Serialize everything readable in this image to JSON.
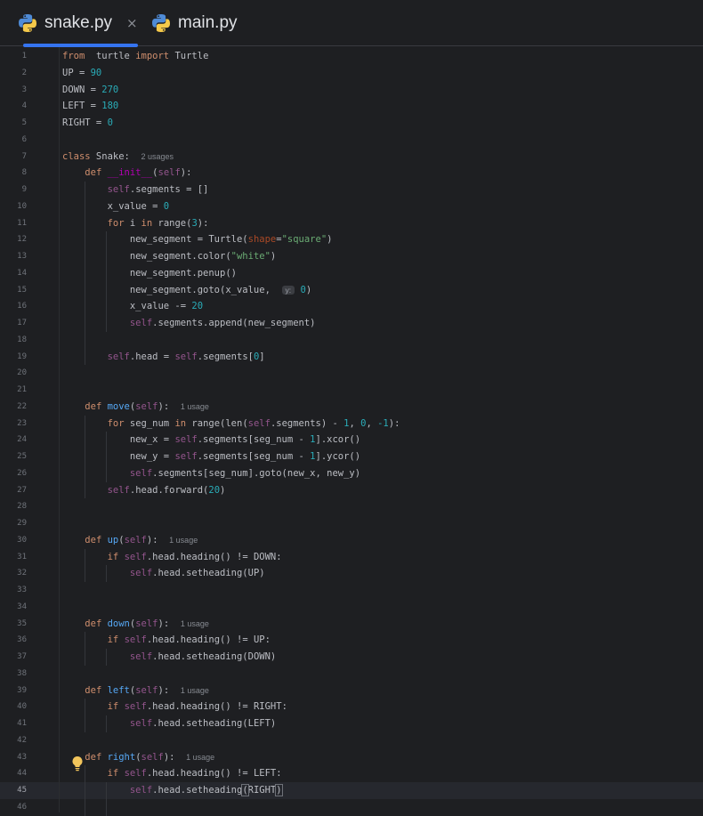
{
  "tabs": [
    {
      "label": "snake.py",
      "close": "×",
      "active": true,
      "icon": "python-icon"
    },
    {
      "label": "main.py",
      "active": false,
      "icon": "python-icon"
    }
  ],
  "editor": {
    "current_line": 45,
    "lines": [
      {
        "n": "1",
        "t": [
          [
            "k",
            "from"
          ],
          [
            "",
            "  turtle "
          ],
          [
            "k",
            "import"
          ],
          [
            "",
            " Turtle"
          ]
        ]
      },
      {
        "n": "2",
        "t": [
          [
            "",
            "UP = "
          ],
          [
            "n",
            "90"
          ]
        ]
      },
      {
        "n": "3",
        "t": [
          [
            "",
            "DOWN = "
          ],
          [
            "n",
            "270"
          ]
        ]
      },
      {
        "n": "4",
        "t": [
          [
            "",
            "LEFT = "
          ],
          [
            "n",
            "180"
          ]
        ]
      },
      {
        "n": "5",
        "t": [
          [
            "",
            "RIGHT = "
          ],
          [
            "n",
            "0"
          ]
        ]
      },
      {
        "n": "6",
        "t": []
      },
      {
        "n": "7",
        "t": [
          [
            "k",
            "class"
          ],
          [
            "",
            " Snake:  "
          ],
          [
            "hint",
            "2 usages"
          ]
        ]
      },
      {
        "n": "8",
        "t": [
          [
            "",
            "    "
          ],
          [
            "k",
            "def"
          ],
          [
            "",
            " "
          ],
          [
            "m",
            "__init__"
          ],
          [
            "",
            "("
          ],
          [
            "sf",
            "self"
          ],
          [
            "",
            "):"
          ]
        ]
      },
      {
        "n": "9",
        "t": [
          [
            "",
            "        "
          ],
          [
            "sf",
            "self"
          ],
          [
            "",
            ".segments = []"
          ]
        ]
      },
      {
        "n": "10",
        "t": [
          [
            "",
            "        x_value = "
          ],
          [
            "n",
            "0"
          ]
        ]
      },
      {
        "n": "11",
        "t": [
          [
            "",
            "        "
          ],
          [
            "k",
            "for"
          ],
          [
            "",
            " i "
          ],
          [
            "k",
            "in"
          ],
          [
            "",
            " range("
          ],
          [
            "n",
            "3"
          ],
          [
            "",
            "):"
          ]
        ]
      },
      {
        "n": "12",
        "t": [
          [
            "",
            "            new_segment = Turtle("
          ],
          [
            "p",
            "shape"
          ],
          [
            "",
            "="
          ],
          [
            "s",
            "\"square\""
          ],
          [
            "",
            ")"
          ]
        ]
      },
      {
        "n": "13",
        "t": [
          [
            "",
            "            new_segment.color("
          ],
          [
            "s",
            "\"white\""
          ],
          [
            "",
            ")"
          ]
        ]
      },
      {
        "n": "14",
        "t": [
          [
            "",
            "            new_segment.penup()"
          ]
        ]
      },
      {
        "n": "15",
        "t": [
          [
            "",
            "            new_segment.goto(x_value,  "
          ],
          [
            "ph",
            "y:"
          ],
          [
            "",
            " "
          ],
          [
            "n",
            "0"
          ],
          [
            "",
            ")"
          ]
        ]
      },
      {
        "n": "16",
        "t": [
          [
            "",
            "            x_value -= "
          ],
          [
            "n",
            "20"
          ]
        ]
      },
      {
        "n": "17",
        "t": [
          [
            "",
            "            "
          ],
          [
            "sf",
            "self"
          ],
          [
            "",
            ".segments.append(new_segment)"
          ]
        ]
      },
      {
        "n": "18",
        "t": []
      },
      {
        "n": "19",
        "t": [
          [
            "",
            "        "
          ],
          [
            "sf",
            "self"
          ],
          [
            "",
            ".head = "
          ],
          [
            "sf",
            "self"
          ],
          [
            "",
            ".segments["
          ],
          [
            "n",
            "0"
          ],
          [
            "",
            "]"
          ]
        ]
      },
      {
        "n": "20",
        "t": []
      },
      {
        "n": "21",
        "t": []
      },
      {
        "n": "22",
        "t": [
          [
            "",
            "    "
          ],
          [
            "k",
            "def"
          ],
          [
            "",
            " "
          ],
          [
            "f",
            "move"
          ],
          [
            "",
            "("
          ],
          [
            "sf",
            "self"
          ],
          [
            "",
            "):  "
          ],
          [
            "hint",
            "1 usage"
          ]
        ]
      },
      {
        "n": "23",
        "t": [
          [
            "",
            "        "
          ],
          [
            "k",
            "for"
          ],
          [
            "",
            " seg_num "
          ],
          [
            "k",
            "in"
          ],
          [
            "",
            " range(len("
          ],
          [
            "sf",
            "self"
          ],
          [
            "",
            ".segments) - "
          ],
          [
            "n",
            "1"
          ],
          [
            "",
            ", "
          ],
          [
            "n",
            "0"
          ],
          [
            "",
            ", "
          ],
          [
            "n",
            "-1"
          ],
          [
            "",
            "):"
          ]
        ]
      },
      {
        "n": "24",
        "t": [
          [
            "",
            "            new_x = "
          ],
          [
            "sf",
            "self"
          ],
          [
            "",
            ".segments[seg_num - "
          ],
          [
            "n",
            "1"
          ],
          [
            "",
            "].xcor()"
          ]
        ]
      },
      {
        "n": "25",
        "t": [
          [
            "",
            "            new_y = "
          ],
          [
            "sf",
            "self"
          ],
          [
            "",
            ".segments[seg_num - "
          ],
          [
            "n",
            "1"
          ],
          [
            "",
            "].ycor()"
          ]
        ]
      },
      {
        "n": "26",
        "t": [
          [
            "",
            "            "
          ],
          [
            "sf",
            "self"
          ],
          [
            "",
            ".segments[seg_num].goto(new_x, new_y)"
          ]
        ]
      },
      {
        "n": "27",
        "t": [
          [
            "",
            "        "
          ],
          [
            "sf",
            "self"
          ],
          [
            "",
            ".head.forward("
          ],
          [
            "n",
            "20"
          ],
          [
            "",
            ")"
          ]
        ]
      },
      {
        "n": "28",
        "t": []
      },
      {
        "n": "29",
        "t": []
      },
      {
        "n": "30",
        "t": [
          [
            "",
            "    "
          ],
          [
            "k",
            "def"
          ],
          [
            "",
            " "
          ],
          [
            "f",
            "up"
          ],
          [
            "",
            "("
          ],
          [
            "sf",
            "self"
          ],
          [
            "",
            "):  "
          ],
          [
            "hint",
            "1 usage"
          ]
        ]
      },
      {
        "n": "31",
        "t": [
          [
            "",
            "        "
          ],
          [
            "k",
            "if"
          ],
          [
            "",
            " "
          ],
          [
            "sf",
            "self"
          ],
          [
            "",
            ".head.heading() != DOWN:"
          ]
        ]
      },
      {
        "n": "32",
        "t": [
          [
            "",
            "            "
          ],
          [
            "sf",
            "self"
          ],
          [
            "",
            ".head.setheading(UP)"
          ]
        ]
      },
      {
        "n": "33",
        "t": []
      },
      {
        "n": "34",
        "t": []
      },
      {
        "n": "35",
        "t": [
          [
            "",
            "    "
          ],
          [
            "k",
            "def"
          ],
          [
            "",
            " "
          ],
          [
            "f",
            "down"
          ],
          [
            "",
            "("
          ],
          [
            "sf",
            "self"
          ],
          [
            "",
            "):  "
          ],
          [
            "hint",
            "1 usage"
          ]
        ]
      },
      {
        "n": "36",
        "t": [
          [
            "",
            "        "
          ],
          [
            "k",
            "if"
          ],
          [
            "",
            " "
          ],
          [
            "sf",
            "self"
          ],
          [
            "",
            ".head.heading() != UP:"
          ]
        ]
      },
      {
        "n": "37",
        "t": [
          [
            "",
            "            "
          ],
          [
            "sf",
            "self"
          ],
          [
            "",
            ".head.setheading(DOWN)"
          ]
        ]
      },
      {
        "n": "38",
        "t": []
      },
      {
        "n": "39",
        "t": [
          [
            "",
            "    "
          ],
          [
            "k",
            "def"
          ],
          [
            "",
            " "
          ],
          [
            "f",
            "left"
          ],
          [
            "",
            "("
          ],
          [
            "sf",
            "self"
          ],
          [
            "",
            "):  "
          ],
          [
            "hint",
            "1 usage"
          ]
        ]
      },
      {
        "n": "40",
        "t": [
          [
            "",
            "        "
          ],
          [
            "k",
            "if"
          ],
          [
            "",
            " "
          ],
          [
            "sf",
            "self"
          ],
          [
            "",
            ".head.heading() != RIGHT:"
          ]
        ]
      },
      {
        "n": "41",
        "t": [
          [
            "",
            "            "
          ],
          [
            "sf",
            "self"
          ],
          [
            "",
            ".head.setheading(LEFT)"
          ]
        ]
      },
      {
        "n": "42",
        "t": []
      },
      {
        "n": "43",
        "t": [
          [
            "",
            "    "
          ],
          [
            "k",
            "def"
          ],
          [
            "",
            " "
          ],
          [
            "f",
            "right"
          ],
          [
            "",
            "("
          ],
          [
            "sf",
            "self"
          ],
          [
            "",
            "):  "
          ],
          [
            "hint",
            "1 usage"
          ]
        ]
      },
      {
        "n": "44",
        "t": [
          [
            "",
            "        "
          ],
          [
            "k",
            "if"
          ],
          [
            "",
            " "
          ],
          [
            "sf",
            "self"
          ],
          [
            "",
            ".head.heading() != LEFT:"
          ]
        ]
      },
      {
        "n": "45",
        "t": [
          [
            "",
            "            "
          ],
          [
            "sf",
            "self"
          ],
          [
            "",
            ".head.setheading"
          ],
          [
            "bracket",
            "("
          ],
          [
            "",
            "RIGHT"
          ],
          [
            "bracket",
            ")"
          ],
          [
            "caret",
            ""
          ]
        ]
      },
      {
        "n": "46",
        "t": []
      }
    ]
  },
  "icons": {
    "intention": "lightbulb-icon"
  },
  "colors": {
    "background": "#1e1f22",
    "keyword": "#cf8e6d",
    "number": "#2aacb8",
    "string": "#6aab73",
    "self": "#94558d",
    "function": "#56a8f5",
    "tab_underline": "#3574f0"
  }
}
